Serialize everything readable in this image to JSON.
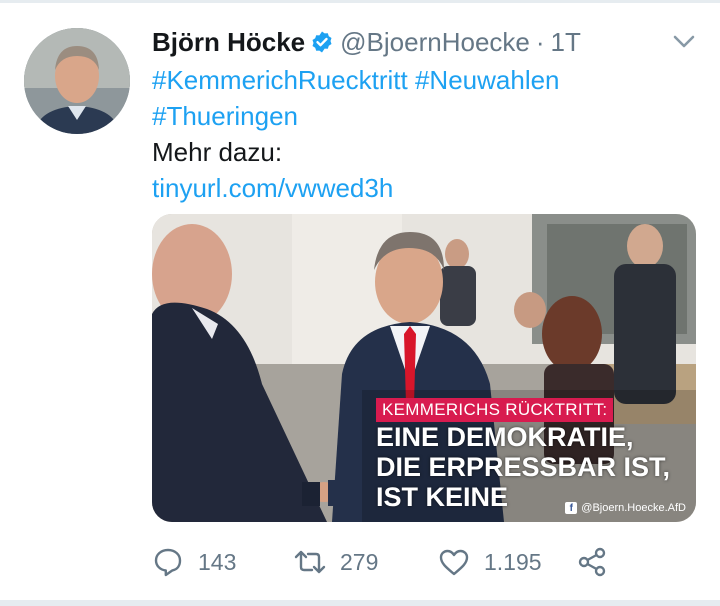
{
  "author": {
    "name": "Björn Höcke",
    "handle": "@BjoernHoecke",
    "separator": "·",
    "time": "1T",
    "verified": true
  },
  "text": {
    "hashtag1": "#KemmerichRuecktritt",
    "hashtag2": "#Neuwahlen",
    "hashtag3": "#Thueringen",
    "line3": "Mehr dazu:",
    "link": "tinyurl.com/vwwed3h"
  },
  "media": {
    "overlay_title": "KEMMERICHS RÜCKTRITT:",
    "overlay_line1": "EINE DEMOKRATIE,",
    "overlay_line2": "DIE ERPRESSBAR IST,",
    "overlay_line3": "IST KEINE",
    "watermark": "@Bjoern.Hoecke.AfD"
  },
  "actions": {
    "replies": "143",
    "retweets": "279",
    "likes": "1.195"
  },
  "colors": {
    "link": "#1da1f2",
    "secondary": "#657786",
    "overlay_tag": "#d81b4f"
  },
  "icons": [
    "verified-badge-icon",
    "chevron-down-icon",
    "reply-icon",
    "retweet-icon",
    "like-icon",
    "share-icon",
    "facebook-icon"
  ]
}
